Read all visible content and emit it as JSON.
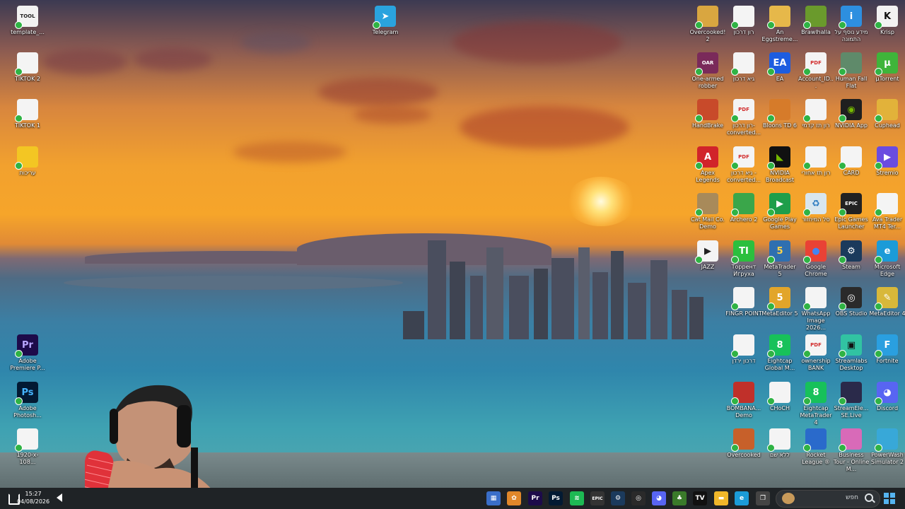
{
  "left_icons": [
    {
      "label": "template_...",
      "icon": "tool-file-icon",
      "color": "#f2f2f2",
      "glyph": "TOOL",
      "glyph_color": "#222"
    },
    {
      "label": "TIKTOK 2",
      "icon": "text-document-icon",
      "color": "#f4f4f4",
      "glyph": "",
      "glyph_color": "#222"
    },
    {
      "label": "TIKTOK 1",
      "icon": "text-document-icon",
      "color": "#f4f4f4",
      "glyph": "",
      "glyph_color": "#222"
    },
    {
      "label": "עריכות",
      "icon": "folder-icon",
      "color": "#f3c623",
      "glyph": "",
      "glyph_color": "#222"
    },
    {
      "label": "Adobe Premiere P...",
      "icon": "premiere-pro-icon",
      "color": "#1d0b4a",
      "glyph": "Pr",
      "glyph_color": "#b9a7ff"
    },
    {
      "label": "Adobe Photosh...",
      "icon": "photoshop-icon",
      "color": "#031a33",
      "glyph": "Ps",
      "glyph_color": "#45b4ff"
    },
    {
      "label": "1920-x-108...",
      "icon": "image-file-icon",
      "color": "#f4f4f4",
      "glyph": "",
      "glyph_color": "#222"
    }
  ],
  "telegram": {
    "label": "Telegram",
    "icon": "telegram-icon",
    "color": "#2aa3de",
    "glyph": "➤",
    "glyph_color": "#fff"
  },
  "right_grid": [
    [
      {
        "label": "Overcooked! 2",
        "icon": "overcooked-2-icon",
        "color": "#d9a640",
        "glyph": "",
        "glyph_color": "#fff"
      },
      {
        "label": "רון דרכון",
        "icon": "image-file-icon",
        "color": "#f4f4f4",
        "glyph": "",
        "glyph_color": "#222"
      },
      {
        "label": "An Eggstreme...",
        "icon": "egg-game-icon",
        "color": "#e6b84a",
        "glyph": "",
        "glyph_color": "#fff"
      },
      {
        "label": "Brawlhalla",
        "icon": "brawlhalla-icon",
        "color": "#6a9a2c",
        "glyph": "",
        "glyph_color": "#fff"
      },
      {
        "label": "מידע נוסף על התמונה",
        "icon": "info-image-icon",
        "color": "#2d8fe0",
        "glyph": "i",
        "glyph_color": "#fff"
      },
      {
        "label": "Krisp",
        "icon": "krisp-icon",
        "color": "#f2f2f2",
        "glyph": "K",
        "glyph_color": "#111"
      }
    ],
    [
      {
        "label": "One-armed robber",
        "icon": "one-armed-robber-icon",
        "color": "#7a2a5a",
        "glyph": "OAR",
        "glyph_color": "#fff"
      },
      {
        "label": "גיא דרכון",
        "icon": "image-file-icon",
        "color": "#f4f4f4",
        "glyph": "",
        "glyph_color": "#222"
      },
      {
        "label": "EA",
        "icon": "ea-icon",
        "color": "#1d5de0",
        "glyph": "EA",
        "glyph_color": "#fff"
      },
      {
        "label": "Account_ID...",
        "icon": "pdf-icon",
        "color": "#f4f4f4",
        "glyph": "PDF",
        "glyph_color": "#d12a2a"
      },
      {
        "label": "Human Fall Flat",
        "icon": "human-fall-flat-icon",
        "color": "#5f8a6a",
        "glyph": "",
        "glyph_color": "#fff"
      },
      {
        "label": "µTorrent",
        "icon": "utorrent-icon",
        "color": "#3fb43a",
        "glyph": "µ",
        "glyph_color": "#fff"
      }
    ],
    [
      {
        "label": "HandBrake",
        "icon": "handbrake-icon",
        "color": "#c84a2a",
        "glyph": "",
        "glyph_color": "#fff"
      },
      {
        "label": "רון דרכון-converted...",
        "icon": "pdf-icon",
        "color": "#f4f4f4",
        "glyph": "PDF",
        "glyph_color": "#d12a2a"
      },
      {
        "label": "Bloons TD 6",
        "icon": "bloons-icon",
        "color": "#d67b2a",
        "glyph": "",
        "glyph_color": "#fff"
      },
      {
        "label": "רון תז קדמי",
        "icon": "image-file-icon",
        "color": "#f4f4f4",
        "glyph": "",
        "glyph_color": "#222"
      },
      {
        "label": "NVIDIA App",
        "icon": "nvidia-icon",
        "color": "#1f1f1f",
        "glyph": "◉",
        "glyph_color": "#76b900"
      },
      {
        "label": "Cuphead",
        "icon": "cuphead-icon",
        "color": "#e2b23a",
        "glyph": "",
        "glyph_color": "#fff"
      }
    ],
    [
      {
        "label": "Apex Legends",
        "icon": "apex-legends-icon",
        "color": "#d1242a",
        "glyph": "A",
        "glyph_color": "#fff"
      },
      {
        "label": "גיא דרכון -converted...",
        "icon": "pdf-icon",
        "color": "#f4f4f4",
        "glyph": "PDF",
        "glyph_color": "#d12a2a"
      },
      {
        "label": "NVIDIA Broadcast",
        "icon": "nvidia-broadcast-icon",
        "color": "#111",
        "glyph": "◣",
        "glyph_color": "#76b900"
      },
      {
        "label": "רון תז אחורי",
        "icon": "image-file-icon",
        "color": "#f4f4f4",
        "glyph": "",
        "glyph_color": "#222"
      },
      {
        "label": "CARD",
        "icon": "image-file-icon",
        "color": "#f4f4f4",
        "glyph": "",
        "glyph_color": "#222"
      },
      {
        "label": "Stremio",
        "icon": "stremio-icon",
        "color": "#6a4ce0",
        "glyph": "▶",
        "glyph_color": "#fff"
      }
    ],
    [
      {
        "label": "Cat Mail Co. Demo",
        "icon": "cat-mail-icon",
        "color": "#a88a5a",
        "glyph": "",
        "glyph_color": "#fff"
      },
      {
        "label": "Archero 2",
        "icon": "archero-icon",
        "color": "#3aa64a",
        "glyph": "",
        "glyph_color": "#fff"
      },
      {
        "label": "Google Play Games",
        "icon": "google-play-games-icon",
        "color": "#1e9e4a",
        "glyph": "▶",
        "glyph_color": "#fff"
      },
      {
        "label": "סל המיחזור",
        "icon": "recycle-bin-icon",
        "color": "#d8e6ee",
        "glyph": "♻",
        "glyph_color": "#2a7ac0"
      },
      {
        "label": "Epic Games Launcher",
        "icon": "epic-games-icon",
        "color": "#222",
        "glyph": "EPIC",
        "glyph_color": "#fff"
      },
      {
        "label": "Ava Trader MT4 Ter...",
        "icon": "generic-file-icon",
        "color": "#f4f4f4",
        "glyph": "",
        "glyph_color": "#222"
      }
    ],
    [
      {
        "label": "JAZZ",
        "icon": "media-file-icon",
        "color": "#f4f4f4",
        "glyph": "▶",
        "glyph_color": "#222"
      },
      {
        "label": "Торрент Игруха",
        "icon": "torrent-igruha-icon",
        "color": "#2bbf3e",
        "glyph": "TI",
        "glyph_color": "#fff"
      },
      {
        "label": "MetaTrader 5",
        "icon": "metatrader5-icon",
        "color": "#2f6fb0",
        "glyph": "5",
        "glyph_color": "#ffd34a"
      },
      {
        "label": "Google Chrome",
        "icon": "chrome-icon",
        "color": "#e94235",
        "glyph": "●",
        "glyph_color": "#4285f4"
      },
      {
        "label": "Steam",
        "icon": "steam-icon",
        "color": "#1b3a5c",
        "glyph": "⚙",
        "glyph_color": "#fff"
      },
      {
        "label": "Microsoft Edge",
        "icon": "edge-icon",
        "color": "#1b9bd8",
        "glyph": "e",
        "glyph_color": "#fff"
      }
    ],
    [
      {
        "label": "FINGR POINT",
        "icon": "image-file-icon",
        "color": "#f4f4f4",
        "glyph": "",
        "glyph_color": "#222"
      },
      {
        "label": "MetaEditor 5",
        "icon": "metaeditor5-icon",
        "color": "#e2a52a",
        "glyph": "5",
        "glyph_color": "#fff"
      },
      {
        "label": "WhatsApp Image 2026...",
        "icon": "image-file-icon",
        "color": "#f4f4f4",
        "glyph": "",
        "glyph_color": "#222"
      },
      {
        "label": "OBS Studio",
        "icon": "obs-icon",
        "color": "#2a2a2a",
        "glyph": "◎",
        "glyph_color": "#fff"
      },
      {
        "label": "MetaEditor 4",
        "icon": "metaeditor4-icon",
        "color": "#d8b83a",
        "glyph": "✎",
        "glyph_color": "#fff"
      }
    ],
    [
      {
        "label": "דרכון ירדן",
        "icon": "image-file-icon",
        "color": "#f4f4f4",
        "glyph": "",
        "glyph_color": "#222"
      },
      {
        "label": "Eightcap Global M...",
        "icon": "eightcap-icon",
        "color": "#17c15a",
        "glyph": "8",
        "glyph_color": "#fff"
      },
      {
        "label": "ownership BANK",
        "icon": "pdf-icon",
        "color": "#f4f4f4",
        "glyph": "PDF",
        "glyph_color": "#d12a2a"
      },
      {
        "label": "Streamlabs Desktop",
        "icon": "streamlabs-icon",
        "color": "#31c3a2",
        "glyph": "▣",
        "glyph_color": "#111"
      },
      {
        "label": "Fortnite",
        "icon": "fortnite-icon",
        "color": "#2a9fe0",
        "glyph": "F",
        "glyph_color": "#fff"
      }
    ],
    [
      {
        "label": "BOMBANA... Demo",
        "icon": "bombana-icon",
        "color": "#c0302a",
        "glyph": "",
        "glyph_color": "#fff"
      },
      {
        "label": "CHoCH",
        "icon": "image-file-icon",
        "color": "#f4f4f4",
        "glyph": "",
        "glyph_color": "#222"
      },
      {
        "label": "Eightcap MetaTrader 4",
        "icon": "eightcap-mt4-icon",
        "color": "#17c15a",
        "glyph": "8",
        "glyph_color": "#fff"
      },
      {
        "label": "StreamEle... SE.Live",
        "icon": "streamelements-icon",
        "color": "#2a2a4a",
        "glyph": "",
        "glyph_color": "#fff"
      },
      {
        "label": "Discord",
        "icon": "discord-icon",
        "color": "#5865f2",
        "glyph": "◕",
        "glyph_color": "#fff"
      }
    ],
    [
      {
        "label": "Overcooked",
        "icon": "overcooked-icon",
        "color": "#c7602a",
        "glyph": "",
        "glyph_color": "#fff"
      },
      {
        "label": "ללא שם",
        "icon": "image-file-icon",
        "color": "#f4f4f4",
        "glyph": "",
        "glyph_color": "#222"
      },
      {
        "label": "Rocket League ®",
        "icon": "rocket-league-icon",
        "color": "#2a6acb",
        "glyph": "",
        "glyph_color": "#fff"
      },
      {
        "label": "Business Tour - Online M...",
        "icon": "business-tour-icon",
        "color": "#d86ab8",
        "glyph": "",
        "glyph_color": "#fff"
      },
      {
        "label": "PowerWash Simulator 2",
        "icon": "powerwash-icon",
        "color": "#38a8d8",
        "glyph": "",
        "glyph_color": "#fff"
      }
    ]
  ],
  "taskbar": {
    "time": "15:27",
    "date": "04/08/2026",
    "search_placeholder": "חפש",
    "apps": [
      {
        "name": "calculator-taskbar-icon",
        "color": "#3a6ec8",
        "glyph": "▦"
      },
      {
        "name": "media-app-taskbar-icon",
        "color": "#e0872a",
        "glyph": "✿"
      },
      {
        "name": "premiere-taskbar-icon",
        "color": "#1d0b4a",
        "glyph": "Pr"
      },
      {
        "name": "photoshop-taskbar-icon",
        "color": "#031a33",
        "glyph": "Ps"
      },
      {
        "name": "spotify-taskbar-icon",
        "color": "#1db954",
        "glyph": "≋"
      },
      {
        "name": "epic-taskbar-icon",
        "color": "#333",
        "glyph": "EPIC"
      },
      {
        "name": "steam-taskbar-icon",
        "color": "#1b3a5c",
        "glyph": "⚙"
      },
      {
        "name": "obs-taskbar-icon",
        "color": "#2a2a2a",
        "glyph": "◎"
      },
      {
        "name": "discord-taskbar-icon",
        "color": "#5865f2",
        "glyph": "◕"
      },
      {
        "name": "game-taskbar-icon",
        "color": "#3a7a2a",
        "glyph": "♣"
      },
      {
        "name": "tradingview-taskbar-icon",
        "color": "#111",
        "glyph": "TV"
      },
      {
        "name": "file-explorer-taskbar-icon",
        "color": "#f0b72a",
        "glyph": "▬"
      },
      {
        "name": "edge-taskbar-icon",
        "color": "#1b9bd8",
        "glyph": "e"
      },
      {
        "name": "task-view-taskbar-icon",
        "color": "#444",
        "glyph": "❐"
      }
    ]
  }
}
